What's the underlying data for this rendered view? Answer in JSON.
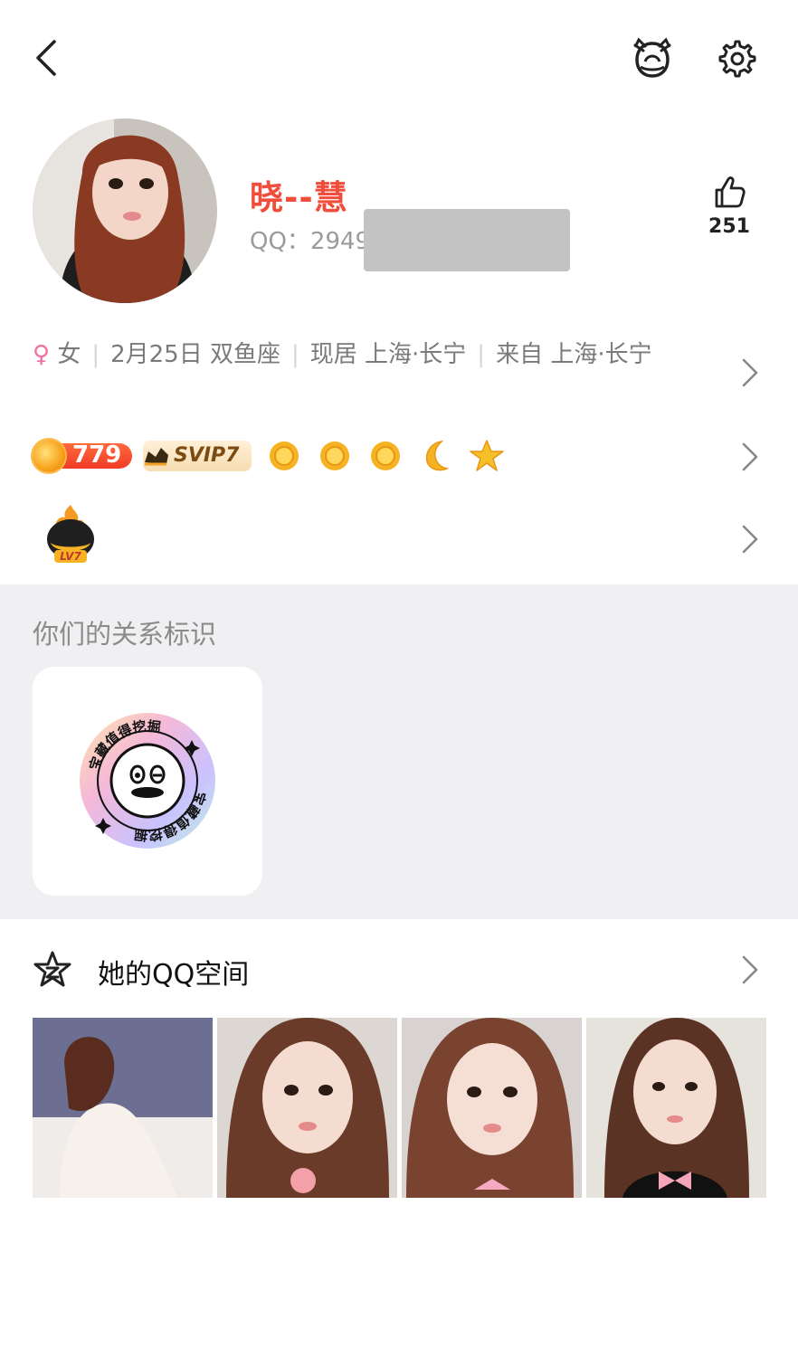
{
  "header": {
    "name": "晓--慧",
    "qq_label": "QQ：2949",
    "likes": "251"
  },
  "info": {
    "sex_symbol": "♀",
    "sex": "女",
    "birthday": "2月25日 双鱼座",
    "residence": "现居 上海·长宁",
    "hometown": "来自 上海·长宁"
  },
  "badges": {
    "level": "779",
    "svip": "SVIP7",
    "level_icons": [
      "sun-icon",
      "sun-icon",
      "sun-icon",
      "moon-icon",
      "star-icon"
    ],
    "lv_badge": "LV7"
  },
  "relationship": {
    "title": "你们的关系标识",
    "sticker_text": "宝藏值得挖掘"
  },
  "qzone": {
    "title": "她的QQ空间",
    "photos": [
      "photo-1",
      "photo-2",
      "photo-3",
      "photo-4"
    ]
  },
  "colors": {
    "name": "#f04d3a",
    "secondary_text": "#9b9b9b",
    "section_bg": "#f0f0f3",
    "female": "#ee6fa1"
  }
}
